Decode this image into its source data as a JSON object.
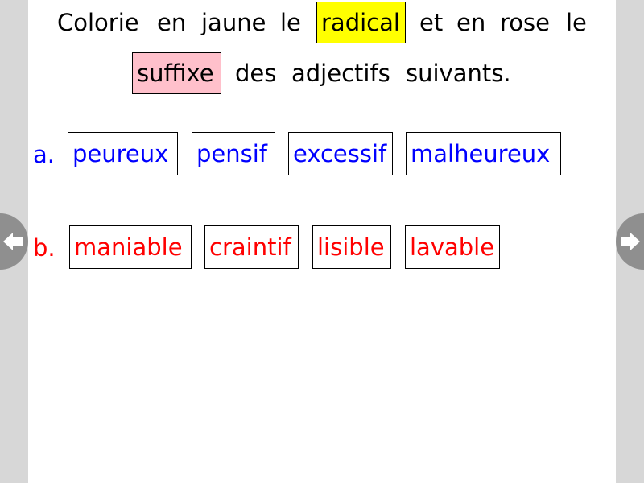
{
  "instruction": {
    "w1": "Colorie",
    "w2": "en",
    "w3": "jaune",
    "w4": "le",
    "radical": "radical",
    "w5": "et",
    "w6": "en",
    "w7": "rose",
    "w8": "le",
    "suffixe": "suffixe",
    "w9": "des",
    "w10": "adjectifs",
    "w11": "suivants."
  },
  "colors": {
    "highlight_yellow": "#ffff00",
    "highlight_pink": "#ffc0cb",
    "row_a": "#0000ff",
    "row_b": "#ff0000"
  },
  "rows": [
    {
      "label": "a.",
      "words": [
        "peureux",
        "pensif",
        "excessif",
        "malheureux"
      ]
    },
    {
      "label": "b.",
      "words": [
        "maniable",
        "craintif",
        "lisible",
        "lavable"
      ]
    }
  ],
  "nav": {
    "prev_icon": "arrow-left-icon",
    "next_icon": "arrow-right-icon"
  }
}
